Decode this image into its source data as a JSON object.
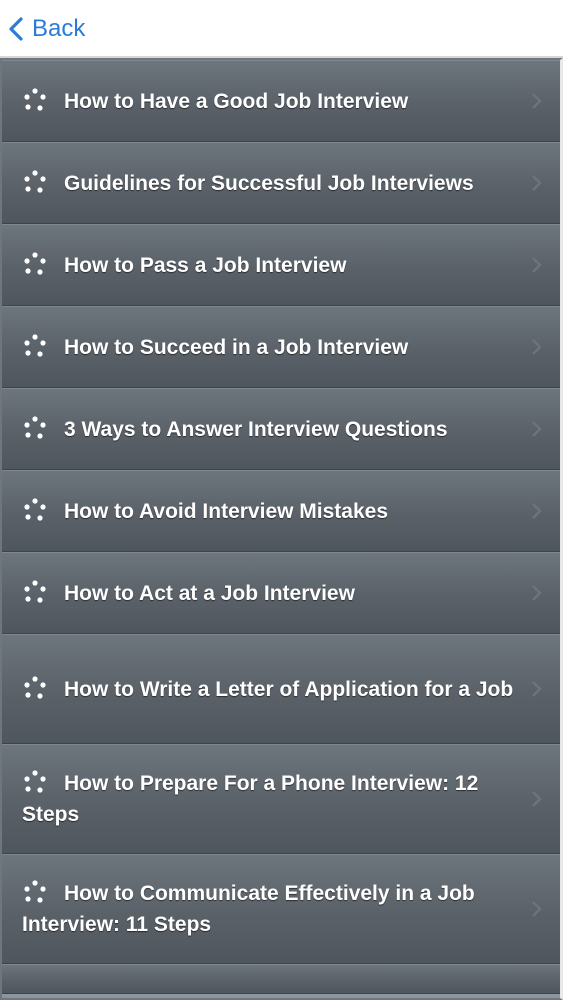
{
  "nav": {
    "back_label": "Back"
  },
  "list": {
    "items": [
      {
        "label": "How to Have a Good Job Interview"
      },
      {
        "label": "Guidelines for Successful Job Interviews"
      },
      {
        "label": "How to Pass a Job Interview"
      },
      {
        "label": "How to Succeed in a Job Interview"
      },
      {
        "label": "3 Ways to Answer Interview Questions"
      },
      {
        "label": "How to Avoid Interview Mistakes"
      },
      {
        "label": "How to Act at a Job Interview"
      },
      {
        "label": "How to Write a Letter of Application for a Job"
      },
      {
        "label": "How to Prepare For a Phone Interview: 12 Steps"
      },
      {
        "label": "How to Communicate Effectively in a Job Interview: 11 Steps"
      }
    ]
  },
  "colors": {
    "accent": "#2b7cd9",
    "row_background": "#5a6168",
    "row_text": "#ffffff"
  }
}
